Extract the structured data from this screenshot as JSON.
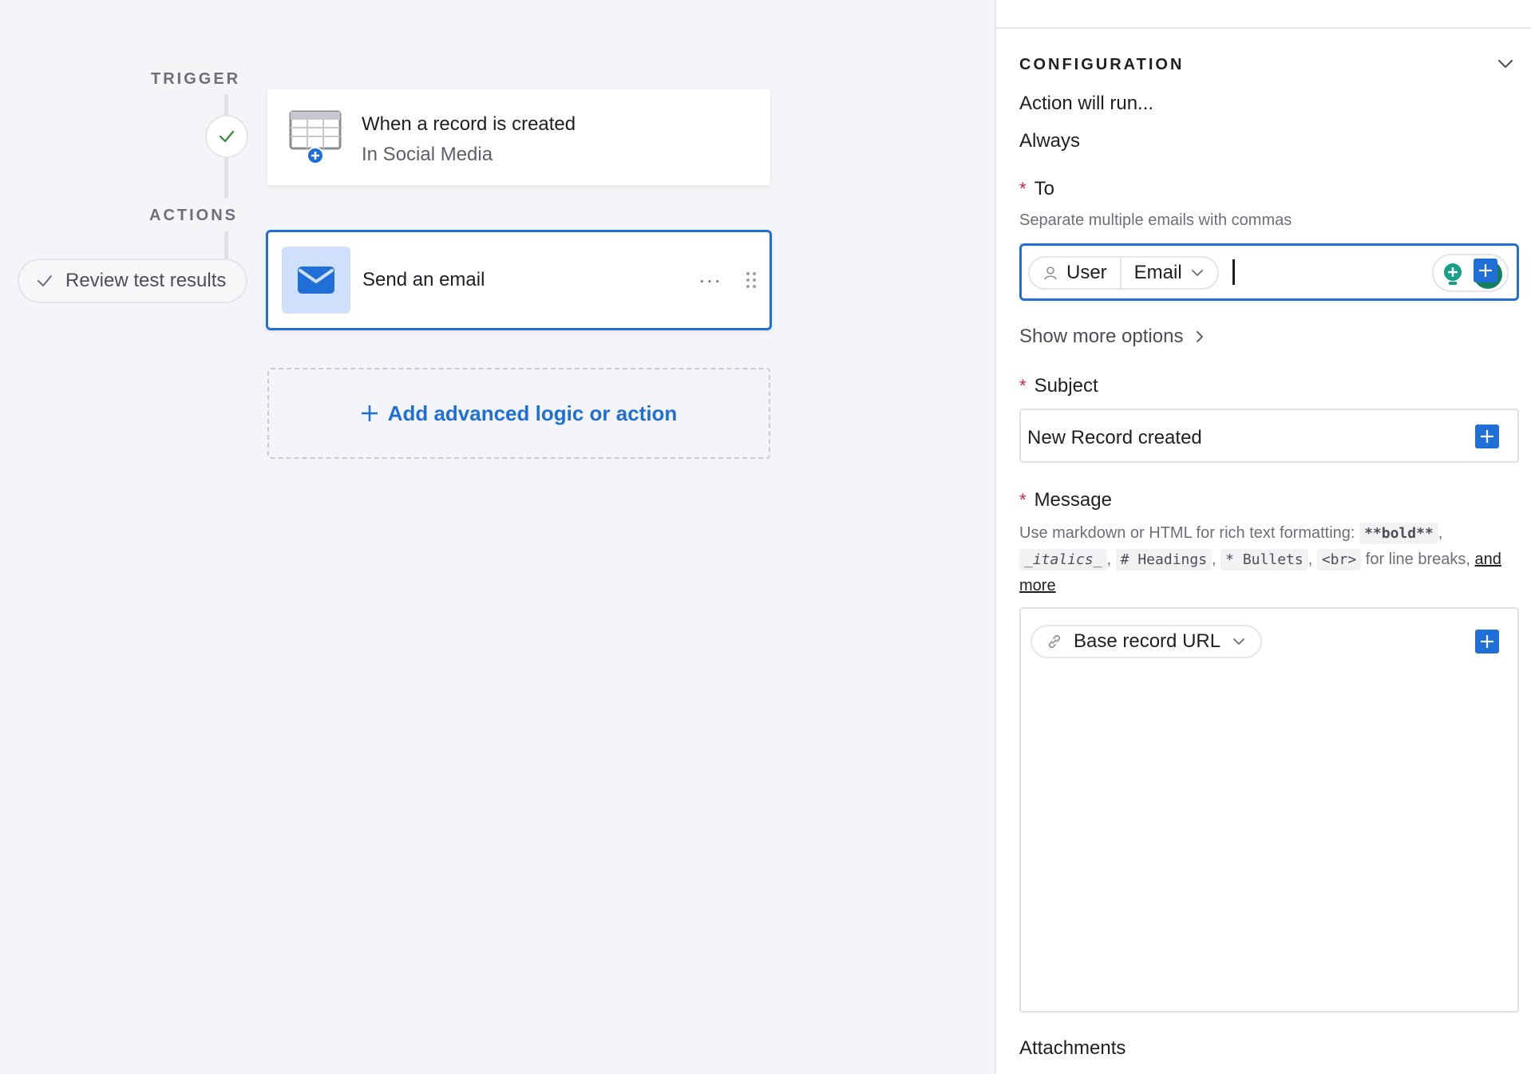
{
  "canvas": {
    "trigger_label": "TRIGGER",
    "actions_label": "ACTIONS",
    "trigger_card": {
      "title": "When a record is created",
      "subtitle": "In Social Media",
      "icon": "table-add-icon"
    },
    "action_card": {
      "title": "Send an email",
      "icon": "envelope-icon",
      "more": "···"
    },
    "review_button": "Review test results",
    "add_action": "Add advanced logic or action"
  },
  "panel": {
    "title": "CONFIGURATION",
    "action_will_run": "Action will run...",
    "run_condition": "Always",
    "to": {
      "label": "To",
      "required_mark": "*",
      "help": "Separate multiple emails with commas",
      "token_user": "User",
      "token_email": "Email"
    },
    "show_more": "Show more options",
    "subject": {
      "label": "Subject",
      "required_mark": "*",
      "value": "New Record created"
    },
    "message": {
      "label": "Message",
      "required_mark": "*",
      "help_prefix": "Use markdown or HTML for rich text formatting:",
      "chip_bold": "**bold**",
      "chip_italics": "_italics_",
      "chip_headings": "# Headings",
      "chip_bullets": "* Bullets",
      "chip_br": "<br>",
      "help_suffix": "for line breaks,",
      "link_and": "and",
      "link_more": "more",
      "token": "Base record URL"
    },
    "attachments_label": "Attachments"
  },
  "colors": {
    "accent": "#1f6fd6",
    "required": "#d4213d",
    "canvas_bg": "#f4f5f8",
    "email_tile": "#cfe0fc",
    "success": "#2e8b3a"
  }
}
